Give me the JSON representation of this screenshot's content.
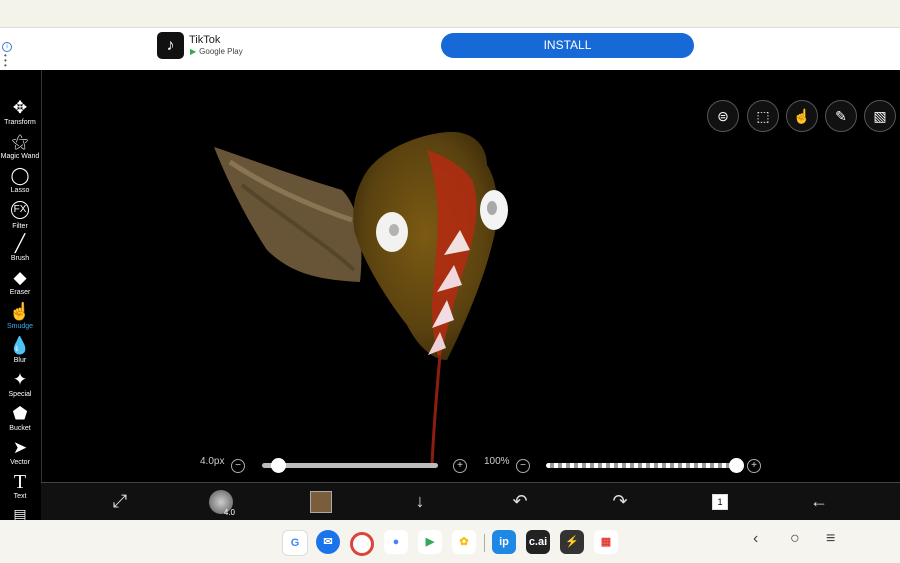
{
  "ad": {
    "app_name": "TikTok",
    "store": "Google Play",
    "install_label": "INSTALL"
  },
  "tools": [
    {
      "label": "Transform",
      "icon": "✥"
    },
    {
      "label": "Magic Wand",
      "icon": "⚝"
    },
    {
      "label": "Lasso",
      "icon": "◯"
    },
    {
      "label": "Filter",
      "icon": "FX"
    },
    {
      "label": "Brush",
      "icon": "╱"
    },
    {
      "label": "Eraser",
      "icon": "◆"
    },
    {
      "label": "Smudge",
      "icon": "☝"
    },
    {
      "label": "Blur",
      "icon": "💧"
    },
    {
      "label": "Special",
      "icon": "✦"
    },
    {
      "label": "Bucket",
      "icon": "⬟"
    },
    {
      "label": "Vector",
      "icon": "➤"
    },
    {
      "label": "Text",
      "icon": "T"
    }
  ],
  "active_tool": "Smudge",
  "brush": {
    "size_label": "4.0px",
    "size_fraction": 0.09,
    "opacity_label": "100%",
    "opacity_fraction": 1.0,
    "preview_number": "4.0"
  },
  "layers_count": "1",
  "colors": {
    "current_color": "#7a5d3a",
    "accent": "#39a8f0",
    "install_blue": "#1769d8"
  },
  "dock": {
    "apps": [
      "Google",
      "Messages",
      "Chrome",
      "Assistant",
      "Play Store",
      "Photos",
      "ibis Paint",
      "c.ai",
      "Spark",
      "Apps"
    ],
    "cai_label": "c.ai"
  }
}
